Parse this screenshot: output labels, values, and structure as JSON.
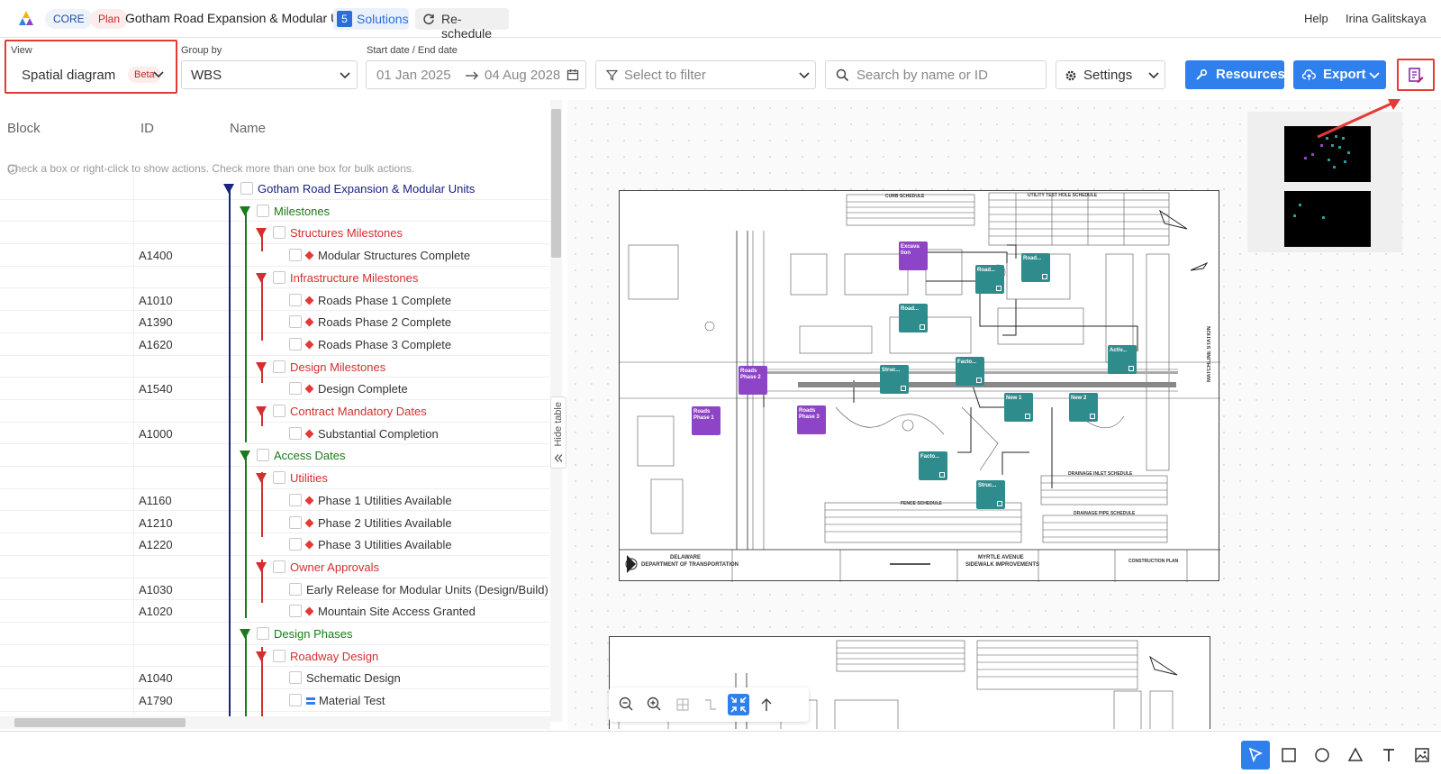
{
  "header": {
    "core_label": "CORE",
    "plan_label": "Plan",
    "project_title": "Gotham Road Expansion & Modular Units",
    "solutions_count": "5",
    "solutions_label": "Solutions",
    "reschedule_label": "Re-schedule",
    "help_label": "Help",
    "user_name": "Irina Galitskaya"
  },
  "toolbar": {
    "view_label": "View",
    "view_value": "Spatial diagram",
    "beta_label": "Beta",
    "group_label": "Group by",
    "group_value": "WBS",
    "date_label": "Start date  /  End date",
    "start_date": "01 Jan 2025",
    "end_date": "04 Aug 2028",
    "filter_placeholder": "Select to filter",
    "search_placeholder": "Search by name or ID",
    "settings_label": "Settings",
    "resources_label": "Resources",
    "export_label": "Export"
  },
  "table": {
    "col_block": "Block",
    "col_id": "ID",
    "col_name": "Name",
    "hint": "Check a box or right-click to show actions. Check more than one box for bulk actions.",
    "hide_table": "Hide table",
    "rows": [
      {
        "id": "",
        "name": "Gotham Road Expansion & Modular Units",
        "level": 0,
        "type": "group",
        "color": "#1a237e"
      },
      {
        "id": "",
        "name": "Milestones",
        "level": 1,
        "type": "group",
        "color": "#1b7a1b"
      },
      {
        "id": "",
        "name": "Structures Milestones",
        "level": 2,
        "type": "group",
        "color": "#d32f2f"
      },
      {
        "id": "A1400",
        "name": "Modular Structures Complete",
        "level": 3,
        "type": "milestone",
        "color": "#333333"
      },
      {
        "id": "",
        "name": "Infrastructure Milestones",
        "level": 2,
        "type": "group",
        "color": "#d32f2f"
      },
      {
        "id": "A1010",
        "name": "Roads Phase 1 Complete",
        "level": 3,
        "type": "milestone",
        "color": "#333333"
      },
      {
        "id": "A1390",
        "name": "Roads Phase 2 Complete",
        "level": 3,
        "type": "milestone",
        "color": "#333333"
      },
      {
        "id": "A1620",
        "name": "Roads Phase 3 Complete",
        "level": 3,
        "type": "milestone",
        "color": "#333333"
      },
      {
        "id": "",
        "name": "Design Milestones",
        "level": 2,
        "type": "group",
        "color": "#d32f2f"
      },
      {
        "id": "A1540",
        "name": "Design Complete",
        "level": 3,
        "type": "milestone",
        "color": "#333333"
      },
      {
        "id": "",
        "name": "Contract Mandatory Dates",
        "level": 2,
        "type": "group",
        "color": "#d32f2f"
      },
      {
        "id": "A1000",
        "name": "Substantial Completion",
        "level": 3,
        "type": "milestone",
        "color": "#333333"
      },
      {
        "id": "",
        "name": "Access Dates",
        "level": 1,
        "type": "group",
        "color": "#1b7a1b"
      },
      {
        "id": "",
        "name": "Utilities",
        "level": 2,
        "type": "group",
        "color": "#d32f2f"
      },
      {
        "id": "A1160",
        "name": "Phase 1 Utilities Available",
        "level": 3,
        "type": "milestone",
        "color": "#333333"
      },
      {
        "id": "A1210",
        "name": "Phase 2 Utilities Available",
        "level": 3,
        "type": "milestone",
        "color": "#333333"
      },
      {
        "id": "A1220",
        "name": "Phase 3 Utilities Available",
        "level": 3,
        "type": "milestone",
        "color": "#333333"
      },
      {
        "id": "",
        "name": "Owner Approvals",
        "level": 2,
        "type": "group",
        "color": "#d32f2f"
      },
      {
        "id": "A1030",
        "name": "Early Release for Modular Units (Design/Build)",
        "level": 3,
        "type": "task",
        "color": "#333333"
      },
      {
        "id": "A1020",
        "name": "Mountain Site Access Granted",
        "level": 3,
        "type": "milestone",
        "color": "#333333"
      },
      {
        "id": "",
        "name": "Design Phases",
        "level": 1,
        "type": "group",
        "color": "#1b7a1b"
      },
      {
        "id": "",
        "name": "Roadway Design",
        "level": 2,
        "type": "group",
        "color": "#d32f2f"
      },
      {
        "id": "A1040",
        "name": "Schematic Design",
        "level": 3,
        "type": "task",
        "color": "#333333"
      },
      {
        "id": "A1790",
        "name": "Material Test",
        "level": 3,
        "type": "bar",
        "color": "#333333"
      }
    ]
  },
  "canvas": {
    "plan_nodes": [
      {
        "label": "Excava tion",
        "color": "purple"
      },
      {
        "label": "Road...",
        "color": "teal"
      },
      {
        "label": "Road...",
        "color": "teal"
      },
      {
        "label": "Road...",
        "color": "teal"
      },
      {
        "label": "Roads Phase 2",
        "color": "purple"
      },
      {
        "label": "Struc...",
        "color": "teal"
      },
      {
        "label": "Facto...",
        "color": "teal"
      },
      {
        "label": "Activ...",
        "color": "teal"
      },
      {
        "label": "Roads Phase 1",
        "color": "purple"
      },
      {
        "label": "Roads Phase 3",
        "color": "purple"
      },
      {
        "label": "New 1",
        "color": "teal"
      },
      {
        "label": "New 2",
        "color": "teal"
      },
      {
        "label": "Facto...",
        "color": "teal"
      },
      {
        "label": "Struc...",
        "color": "teal"
      }
    ],
    "sheet_text": {
      "curb_schedule": "CURB SCHEDULE",
      "utility_schedule": "UTILITY TEST HOLE SCHEDULE",
      "drainage_inlet": "DRAINAGE INLET SCHEDULE",
      "drainage_pipe": "DRAINAGE PIPE SCHEDULE",
      "fence_schedule": "FENCE SCHEDULE",
      "delaware": "DELAWARE",
      "dot": "DEPARTMENT OF TRANSPORTATION",
      "myrtle": "MYRTLE AVENUE",
      "sidewalk": "SIDEWALK IMPROVEMENTS",
      "construction_plan": "CONSTRUCTION PLAN",
      "matchline": "MATCHLINE STATION"
    }
  },
  "colors": {
    "accent": "#2f80ed",
    "highlight": "#e53935",
    "node_purple": "#8e44c7",
    "node_teal": "#2f8c8c"
  }
}
